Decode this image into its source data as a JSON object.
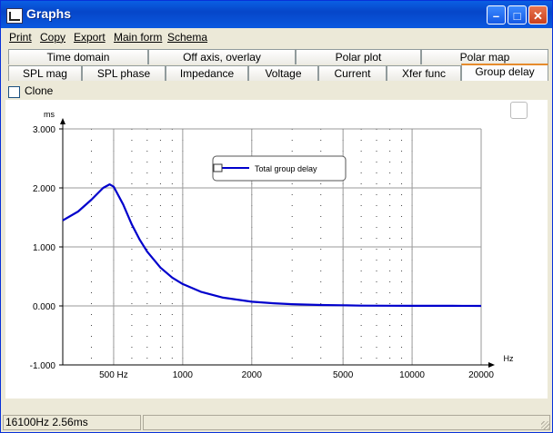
{
  "window": {
    "title": "Graphs"
  },
  "menu": [
    "Print",
    "Copy",
    "Export",
    "Main form",
    "Schema"
  ],
  "tabs_row1": [
    "Time domain",
    "Off axis, overlay",
    "Polar plot",
    "Polar map"
  ],
  "tabs_row2": [
    "SPL mag",
    "SPL phase",
    "Impedance",
    "Voltage",
    "Current",
    "Xfer func",
    "Group delay"
  ],
  "active_tab": "Group delay",
  "clone_label": "Clone",
  "status": {
    "readout": "16100Hz 2.56ms"
  },
  "chart_data": {
    "type": "line",
    "xscale": "log",
    "xlabel": "Hz",
    "ylabel": "ms",
    "xlim": [
      300,
      20000
    ],
    "ylim": [
      -1,
      3
    ],
    "yticks": [
      "3.000",
      "2.000",
      "1.000",
      "0.000",
      "-1.000"
    ],
    "xticks": [
      {
        "v": 500,
        "label": "500 Hz"
      },
      {
        "v": 1000,
        "label": "1000"
      },
      {
        "v": 2000,
        "label": "2000"
      },
      {
        "v": 5000,
        "label": "5000"
      },
      {
        "v": 10000,
        "label": "10000"
      },
      {
        "v": 20000,
        "label": "20000"
      }
    ],
    "legend_placement": "top-center",
    "series": [
      {
        "name": "Total group delay",
        "color": "#0000cc",
        "x": [
          300,
          350,
          400,
          450,
          480,
          500,
          550,
          600,
          650,
          700,
          800,
          900,
          1000,
          1200,
          1500,
          2000,
          2500,
          3000,
          4000,
          5000,
          6000,
          8000,
          10000,
          15000,
          20000
        ],
        "y": [
          1.45,
          1.6,
          1.8,
          2.0,
          2.06,
          2.02,
          1.72,
          1.38,
          1.12,
          0.92,
          0.65,
          0.48,
          0.37,
          0.24,
          0.14,
          0.07,
          0.045,
          0.03,
          0.015,
          0.01,
          0.005,
          0.003,
          0.002,
          0.001,
          0.0
        ]
      }
    ]
  },
  "colors": {
    "titlebar": "#0a5fe3",
    "accent_tab": "#e68b2c",
    "curve": "#0000cc"
  }
}
